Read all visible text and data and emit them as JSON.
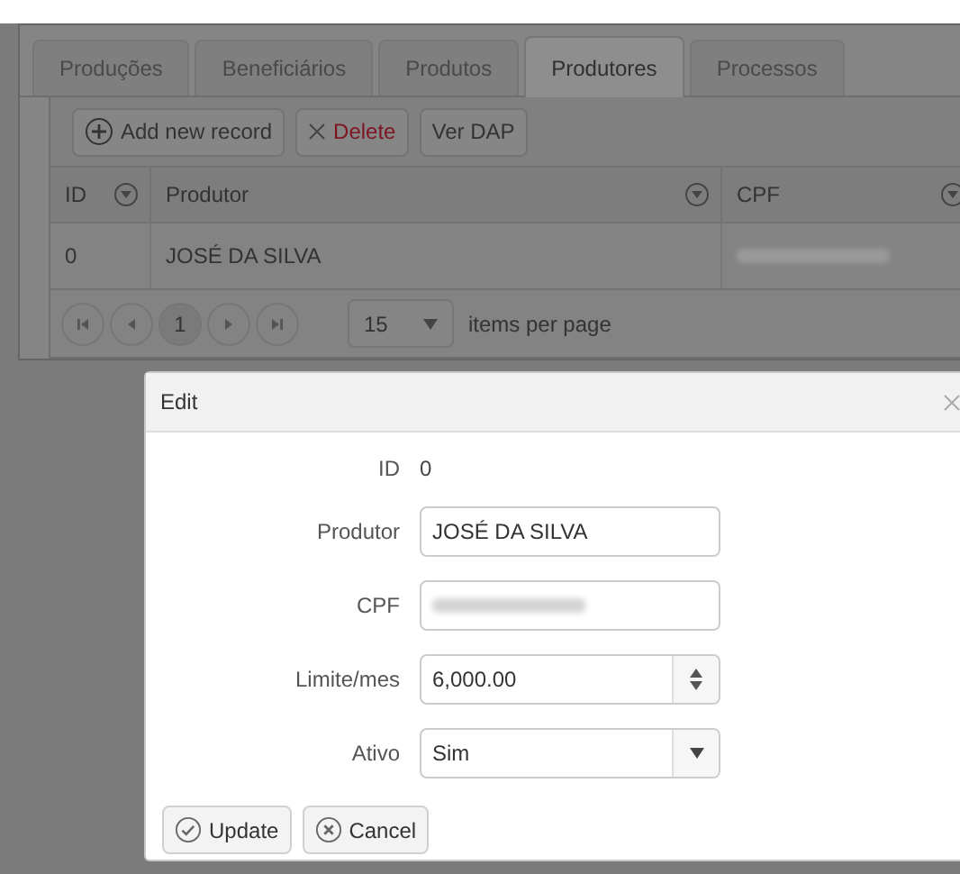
{
  "tabs": [
    {
      "label": "Produções",
      "selected": false
    },
    {
      "label": "Beneficiários",
      "selected": false
    },
    {
      "label": "Produtos",
      "selected": false
    },
    {
      "label": "Produtores",
      "selected": true
    },
    {
      "label": "Processos",
      "selected": false
    }
  ],
  "toolbar": [
    {
      "kind": "add",
      "label": "Add new record"
    },
    {
      "kind": "delete",
      "label": "Delete"
    },
    {
      "kind": "plain",
      "label": "Ver DAP"
    }
  ],
  "table": {
    "columns": [
      "ID",
      "Produtor",
      "CPF"
    ],
    "rows": [
      {
        "id": "0",
        "produtor": "JOSÉ DA SILVA"
      }
    ]
  },
  "pager": {
    "page": "1",
    "page_size": "15",
    "label": "items per page"
  },
  "dialog": {
    "title": "Edit",
    "fields": [
      {
        "kind": "static",
        "label": "ID",
        "value": "0"
      },
      {
        "kind": "text",
        "label": "Produtor",
        "value": "JOSÉ DA SILVA"
      },
      {
        "kind": "blurred",
        "label": "CPF"
      },
      {
        "kind": "numeric",
        "label": "Limite/mes",
        "value": "6,000.00"
      },
      {
        "kind": "select",
        "label": "Ativo",
        "value": "Sim"
      }
    ],
    "buttons": [
      {
        "kind": "update",
        "label": "Update"
      },
      {
        "kind": "cancel",
        "label": "Cancel"
      }
    ]
  }
}
